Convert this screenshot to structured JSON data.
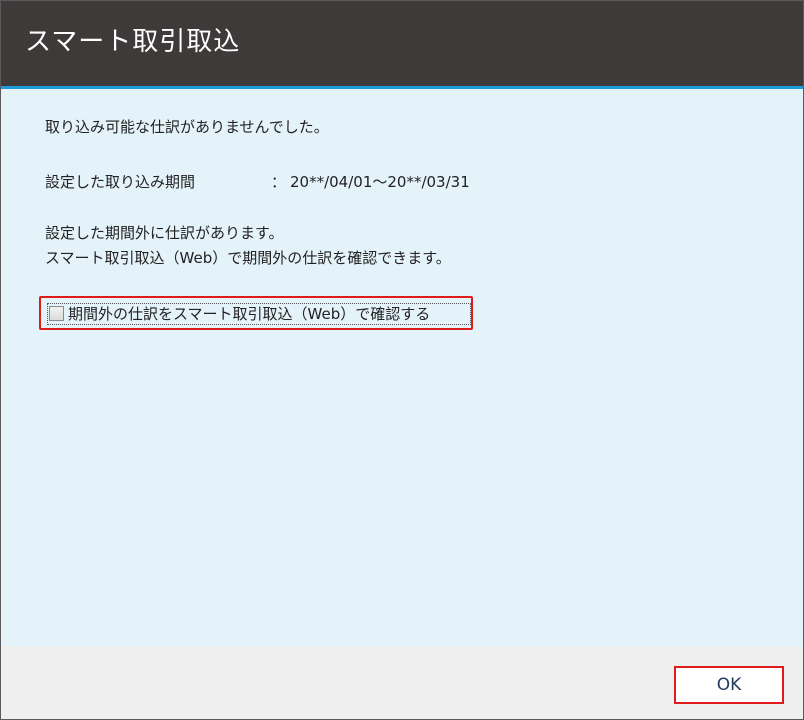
{
  "dialog": {
    "title": "スマート取引取込",
    "message_no_entries": "取り込み可能な仕訳がありませんでした。",
    "period": {
      "label": "設定した取り込み期間",
      "separator": "：",
      "value": "20**/04/01～20**/03/31"
    },
    "out_of_period_line1": "設定した期間外に仕訳があります。",
    "out_of_period_line2": "スマート取引取込（Web）で期間外の仕訳を確認できます。",
    "checkbox": {
      "label": "期間外の仕訳をスマート取引取込（Web）で確認する",
      "checked": false
    },
    "ok_label": "OK"
  },
  "colors": {
    "titlebar": "#3e3a39",
    "accent_line": "#1d9bd8",
    "content_bg": "#e4f2fa",
    "footer_bg": "#efefef",
    "highlight": "#e01b1b"
  }
}
